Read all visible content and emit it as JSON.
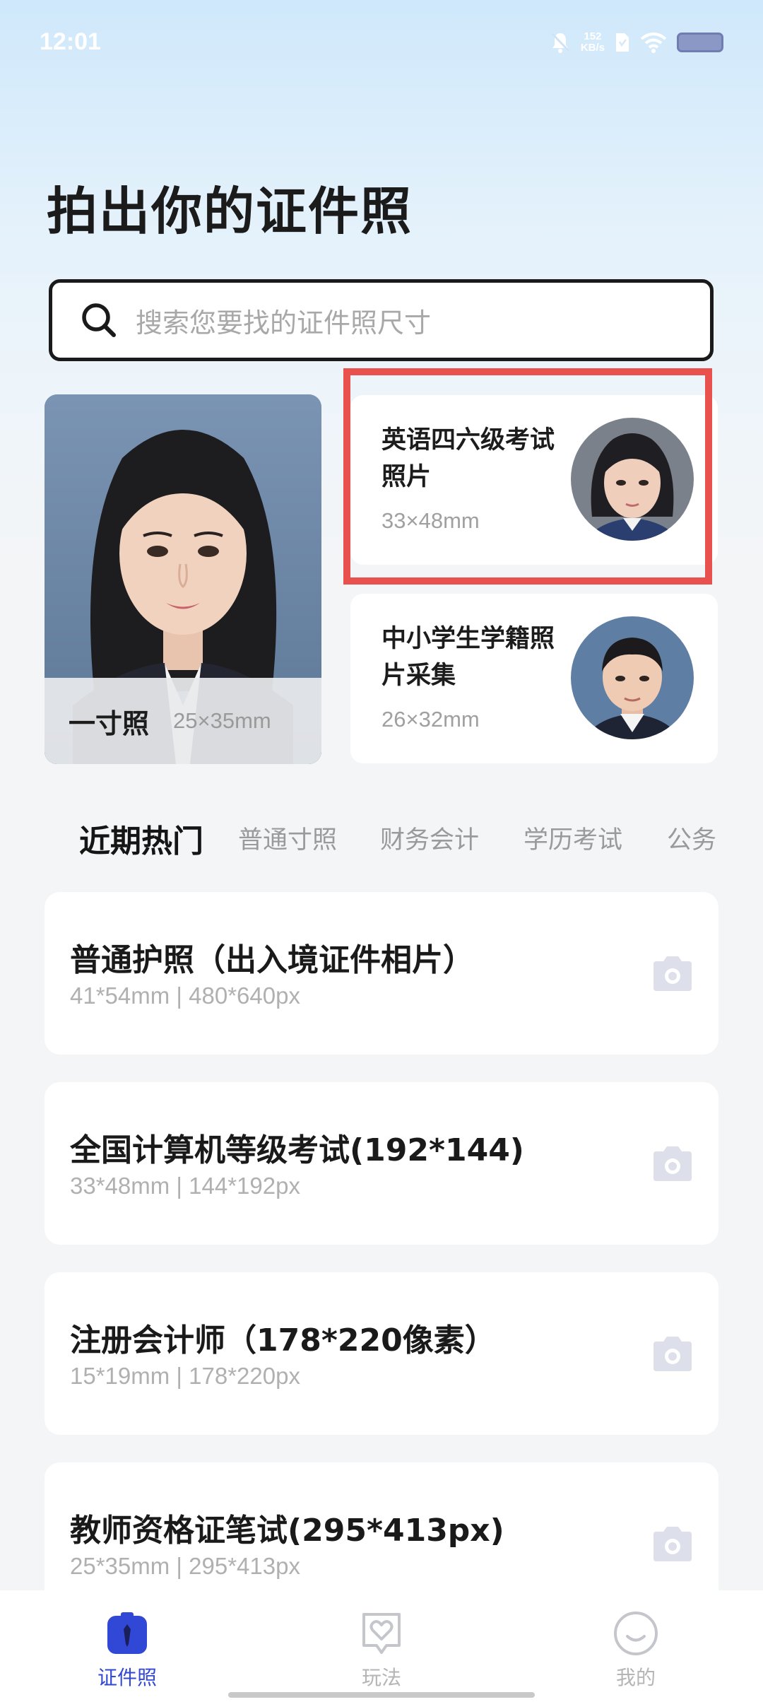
{
  "status_bar": {
    "time": "12:01",
    "net_speed_value": "152",
    "net_speed_unit": "KB/s",
    "icons": [
      "mute-bell-icon",
      "sim-icon",
      "wifi-icon",
      "battery-icon"
    ]
  },
  "header": {
    "title": "拍出你的证件照"
  },
  "search": {
    "placeholder": "搜索您要找的证件照尺寸"
  },
  "features": {
    "large": {
      "name": "一寸照",
      "size": "25×35mm"
    },
    "small": [
      {
        "title": "英语四六级考试照片",
        "size": "33×48mm"
      },
      {
        "title": "中小学生学籍照片采集",
        "size": "26×32mm"
      }
    ]
  },
  "tabs": [
    {
      "label": "近期热门",
      "active": true
    },
    {
      "label": "普通寸照",
      "active": false
    },
    {
      "label": "财务会计",
      "active": false
    },
    {
      "label": "学历考试",
      "active": false
    },
    {
      "label": "公务",
      "active": false
    }
  ],
  "list": [
    {
      "title": "普通护照（出入境证件相片）",
      "subtitle": "41*54mm | 480*640px"
    },
    {
      "title": "全国计算机等级考试(192*144)",
      "subtitle": "33*48mm | 144*192px"
    },
    {
      "title": "注册会计师（178*220像素）",
      "subtitle": "15*19mm | 178*220px"
    },
    {
      "title": "教师资格证笔试(295*413px)",
      "subtitle": "25*35mm | 295*413px"
    }
  ],
  "bottom_nav": [
    {
      "label": "证件照",
      "icon": "id-photo-icon",
      "active": true
    },
    {
      "label": "玩法",
      "icon": "heart-chat-icon",
      "active": false
    },
    {
      "label": "我的",
      "icon": "smiley-icon",
      "active": false
    }
  ],
  "colors": {
    "accent": "#3148d6",
    "highlight": "#e8514d",
    "title": "#1b1b1b",
    "muted": "#a0a0a0"
  }
}
